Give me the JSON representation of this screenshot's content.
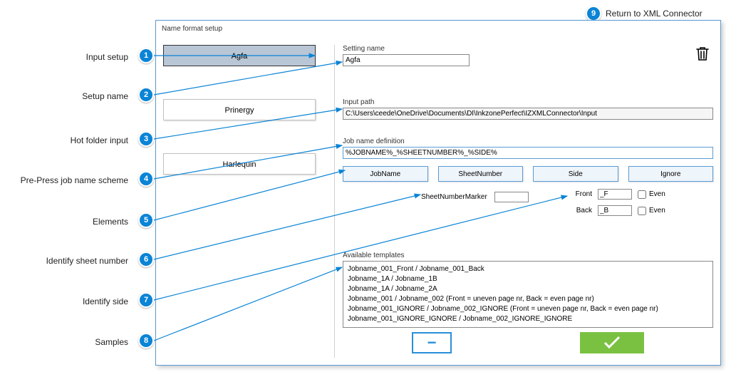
{
  "return_link": "Return to XML Connector",
  "dialog": {
    "title": "Name format setup"
  },
  "setups": {
    "items": [
      {
        "label": "Agfa"
      },
      {
        "label": "Prinergy"
      },
      {
        "label": "Harlequin"
      }
    ]
  },
  "setting_name": {
    "label": "Setting name",
    "value": "Agfa"
  },
  "input_path": {
    "label": "Input path",
    "value": "C:\\Users\\ceede\\OneDrive\\Documents\\DI\\InkzonePerfect\\IZXMLConnector\\Input"
  },
  "job_def": {
    "label": "Job name definition",
    "value": "%JOBNAME%_%SHEETNUMBER%_%SIDE%"
  },
  "tokens": {
    "jobname": "JobName",
    "sheetnumber": "SheetNumber",
    "side": "Side",
    "ignore": "Ignore"
  },
  "marker": {
    "label": "SheetNumberMarker",
    "value": ""
  },
  "sides": {
    "front_label": "Front",
    "front_value": "_F",
    "front_even": "Even",
    "back_label": "Back",
    "back_value": "_B",
    "back_even": "Even"
  },
  "templates": {
    "label": "Available templates",
    "lines": [
      "Jobname_001_Front / Jobname_001_Back",
      "Jobname_1A / Jobname_1B",
      "Jobname_1A / Jobname_2A",
      "Jobname_001 / Jobname_002 (Front = uneven page nr, Back = even page nr)",
      "Jobname_001_IGNORE / Jobname_002_IGNORE (Front = uneven page nr, Back = even page nr)",
      "Jobname_001_IGNORE_IGNORE / Jobname_002_IGNORE_IGNORE"
    ]
  },
  "callouts": {
    "c1": "Input setup",
    "c2": "Setup name",
    "c3": "Hot folder input",
    "c4": "Pre-Press job name scheme",
    "c5": "Elements",
    "c6": "Identify sheet number",
    "c7": "Identify side",
    "c8": "Samples"
  },
  "badges": {
    "b1": "1",
    "b2": "2",
    "b3": "3",
    "b4": "4",
    "b5": "5",
    "b6": "6",
    "b7": "7",
    "b8": "8",
    "b9": "9"
  }
}
